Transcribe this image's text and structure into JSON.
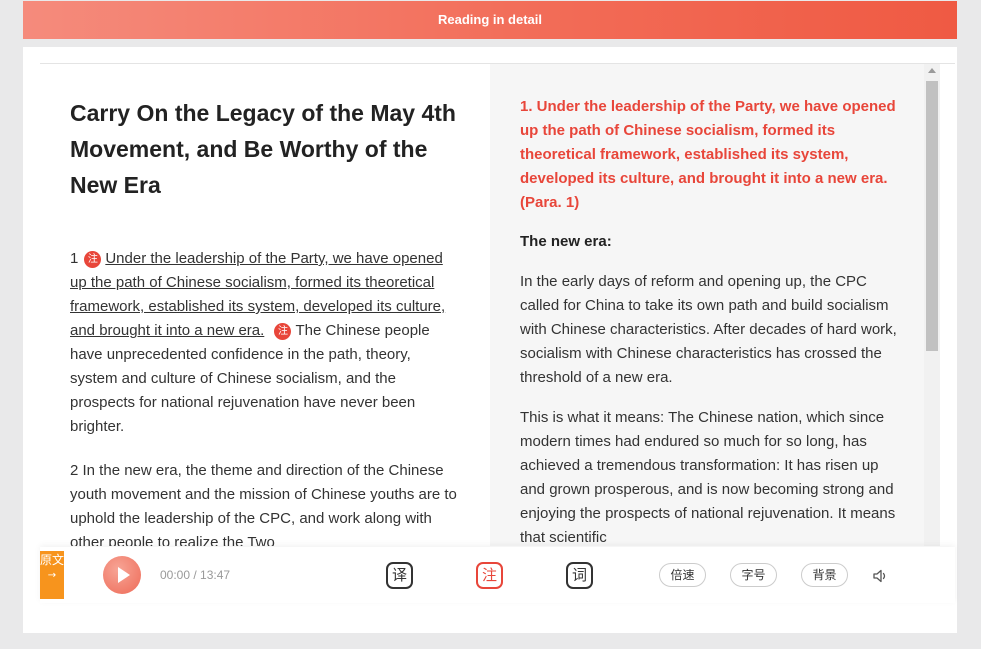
{
  "header": {
    "title": "Reading in detail"
  },
  "article": {
    "title": "Carry On the Legacy of the May 4th Movement, and Be Worthy of the New Era",
    "p1_number": "1",
    "note_badge": "注",
    "p1_underlined": "Under the leadership of the Party, we have opened up the path of Chinese socialism, formed its theoretical framework, established its system, developed its culture, and brought it into a new era.",
    "p1_rest": "The Chinese people have unprecedented confidence in the path, theory, system and culture of Chinese socialism, and the prospects for national rejuvenation have never been brighter.",
    "p2": "2 In the new era, the theme and direction of the Chinese youth movement and the mission of Chinese youths are to uphold the leadership of the CPC, and work along with other people to realize the Two"
  },
  "notes": {
    "heading": "1. Under the leadership of the Party, we have opened up the path of Chinese socialism, formed its theoretical framework, established its system, developed its culture, and brought it into a new era. (Para. 1)",
    "subheading": "The new era:",
    "para1": "In the early days of reform and opening up, the CPC called for China to take its own path and build socialism with Chinese characteristics. After decades of hard work, socialism with Chinese characteristics has crossed the threshold of a new era.",
    "para2": "This is what it means: The Chinese nation, which since modern times had endured so much for so long, has achieved a tremendous transformation: It has risen up and grown prosperous, and is now becoming strong and enjoying the prospects of national rejuvenation. It means that scientific"
  },
  "player": {
    "original_tab_label": "原文",
    "original_tab_arrow": "→",
    "time": "00:00 / 13:47",
    "translate_label": "译",
    "note_label": "注",
    "word_label": "词",
    "speed_label": "倍速",
    "font_label": "字号",
    "background_label": "背景",
    "volume_icon": "speaker-icon"
  },
  "colors": {
    "accent": "#e8463a",
    "header_gradient_start": "#f58b7c",
    "header_gradient_end": "#ef5a43",
    "orig_tab": "#f7941d"
  }
}
